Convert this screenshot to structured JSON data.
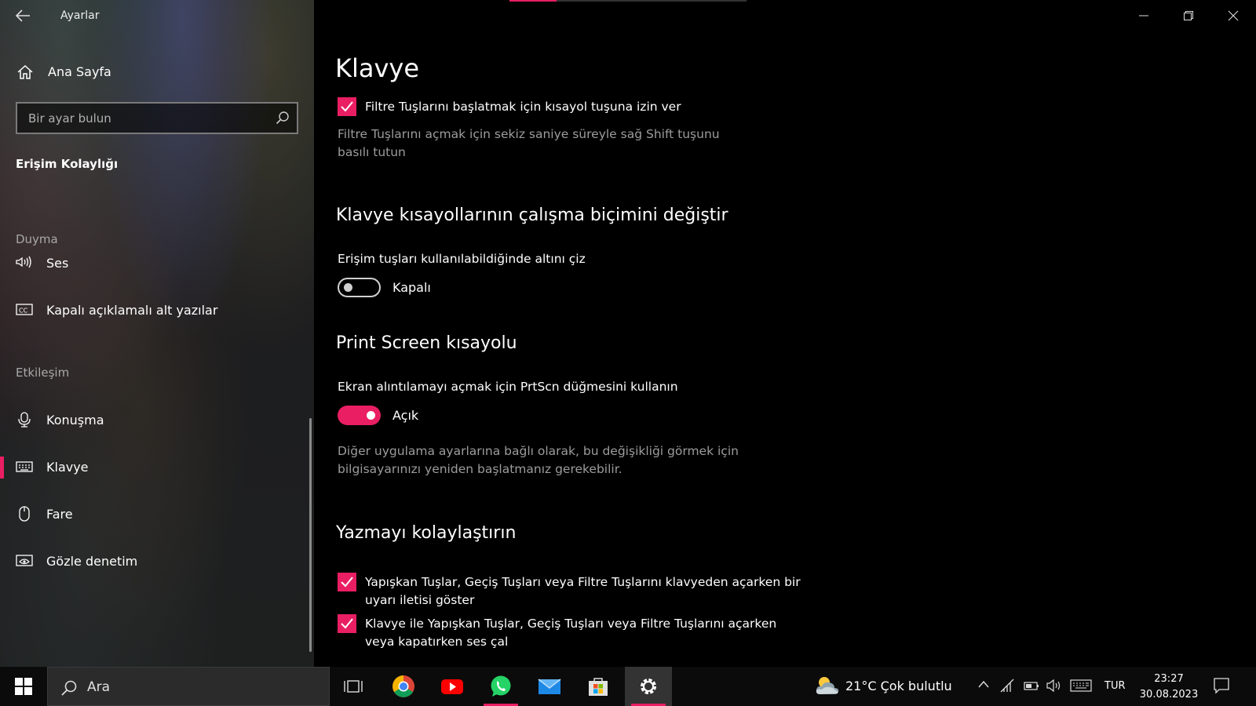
{
  "window": {
    "app_title": "Ayarlar"
  },
  "sidebar": {
    "home_label": "Ana Sayfa",
    "search_placeholder": "Bir ayar bulun",
    "section_title": "Erişim Kolaylığı",
    "groups": [
      {
        "label": "Duyma",
        "items": [
          {
            "label": "Ses",
            "icon": "speaker-icon"
          },
          {
            "label": "Kapalı açıklamalı alt yazılar",
            "icon": "closed-captions-icon"
          }
        ]
      },
      {
        "label": "Etkileşim",
        "items": [
          {
            "label": "Konuşma",
            "icon": "microphone-icon"
          },
          {
            "label": "Klavye",
            "icon": "keyboard-icon",
            "selected": true
          },
          {
            "label": "Fare",
            "icon": "mouse-icon"
          },
          {
            "label": "Gözle denetim",
            "icon": "eye-control-icon"
          }
        ]
      }
    ]
  },
  "main": {
    "page_title": "Klavye",
    "filter_keys_shortcut": {
      "label": "Filtre Tuşlarını başlatmak için kısayol tuşuna izin ver",
      "checked": true,
      "description": "Filtre Tuşlarını açmak için sekiz saniye süreyle sağ Shift tuşunu basılı tutun"
    },
    "shortcuts_section": {
      "title": "Klavye kısayollarının çalışma biçimini değiştir",
      "underline_label": "Erişim tuşları kullanılabildiğinde altını çiz",
      "underline_state": "Kapalı",
      "underline_on": false
    },
    "print_screen_section": {
      "title": "Print Screen kısayolu",
      "label": "Ekran alıntılamayı açmak için PrtScn düğmesini kullanın",
      "state": "Açık",
      "on": true,
      "description": "Diğer uygulama ayarlarına bağlı olarak, bu değişikliği görmek için bilgisayarınızı yeniden başlatmanız gerekebilir."
    },
    "typing_section": {
      "title": "Yazmayı kolaylaştırın",
      "options": [
        {
          "label": "Yapışkan Tuşlar, Geçiş Tuşları veya Filtre Tuşlarını klavyeden açarken bir uyarı iletisi göster",
          "checked": true
        },
        {
          "label": "Klavye ile Yapışkan Tuşlar, Geçiş Tuşları veya Filtre Tuşlarını açarken veya kapatırken ses çal",
          "checked": true
        }
      ]
    }
  },
  "taskbar": {
    "search_placeholder": "Ara",
    "weather": "21°C  Çok bulutlu",
    "language": "TUR",
    "time": "23:27",
    "date": "30.08.2023",
    "apps": [
      "task-view-icon",
      "chrome-icon",
      "youtube-icon",
      "whatsapp-icon",
      "mail-icon",
      "store-icon",
      "settings-icon"
    ]
  },
  "colors": {
    "accent": "#e91e63",
    "background": "#000000",
    "secondary_text": "#9c9c9c"
  }
}
